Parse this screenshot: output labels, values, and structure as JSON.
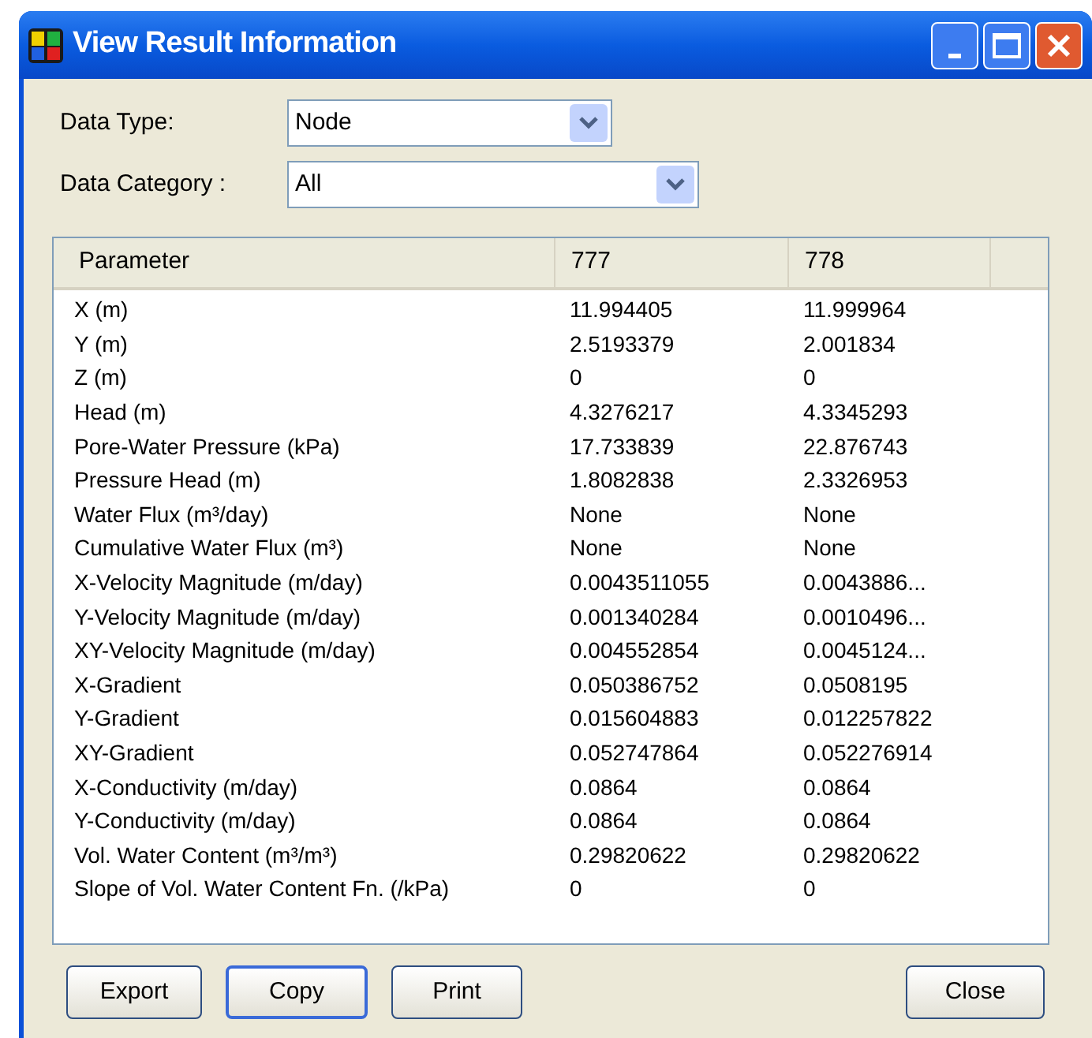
{
  "window": {
    "title": "View Result Information"
  },
  "fields": [
    {
      "label": "Data Type:",
      "value": "Node"
    },
    {
      "label": "Data Category :",
      "value": "All"
    }
  ],
  "table": {
    "columns": [
      "Parameter",
      "777",
      "778"
    ],
    "rows": [
      [
        "X (m)",
        "11.994405",
        "11.999964"
      ],
      [
        "Y (m)",
        "2.5193379",
        "2.001834"
      ],
      [
        "Z (m)",
        "0",
        "0"
      ],
      [
        "Head (m)",
        "4.3276217",
        "4.3345293"
      ],
      [
        "Pore-Water Pressure (kPa)",
        "17.733839",
        "22.876743"
      ],
      [
        "Pressure Head (m)",
        "1.8082838",
        "2.3326953"
      ],
      [
        "Water Flux (m³/day)",
        "None",
        "None"
      ],
      [
        "Cumulative Water Flux (m³)",
        "None",
        "None"
      ],
      [
        "X-Velocity Magnitude (m/day)",
        "0.0043511055",
        "0.0043886..."
      ],
      [
        "Y-Velocity Magnitude (m/day)",
        "0.001340284",
        "0.0010496..."
      ],
      [
        "XY-Velocity Magnitude (m/day)",
        "0.004552854",
        "0.0045124..."
      ],
      [
        "X-Gradient",
        "0.050386752",
        "0.0508195"
      ],
      [
        "Y-Gradient",
        "0.015604883",
        "0.012257822"
      ],
      [
        "XY-Gradient",
        "0.052747864",
        "0.052276914"
      ],
      [
        "X-Conductivity (m/day)",
        "0.0864",
        "0.0864"
      ],
      [
        "Y-Conductivity (m/day)",
        "0.0864",
        "0.0864"
      ],
      [
        "Vol. Water Content (m³/m³)",
        "0.29820622",
        "0.29820622"
      ],
      [
        "Slope of Vol. Water Content Fn. (/kPa)",
        "0",
        "0"
      ]
    ]
  },
  "buttons": [
    {
      "label": "Export",
      "focused": false
    },
    {
      "label": "Copy",
      "focused": true
    },
    {
      "label": "Print",
      "focused": false
    },
    {
      "label": "Close",
      "focused": false
    }
  ]
}
